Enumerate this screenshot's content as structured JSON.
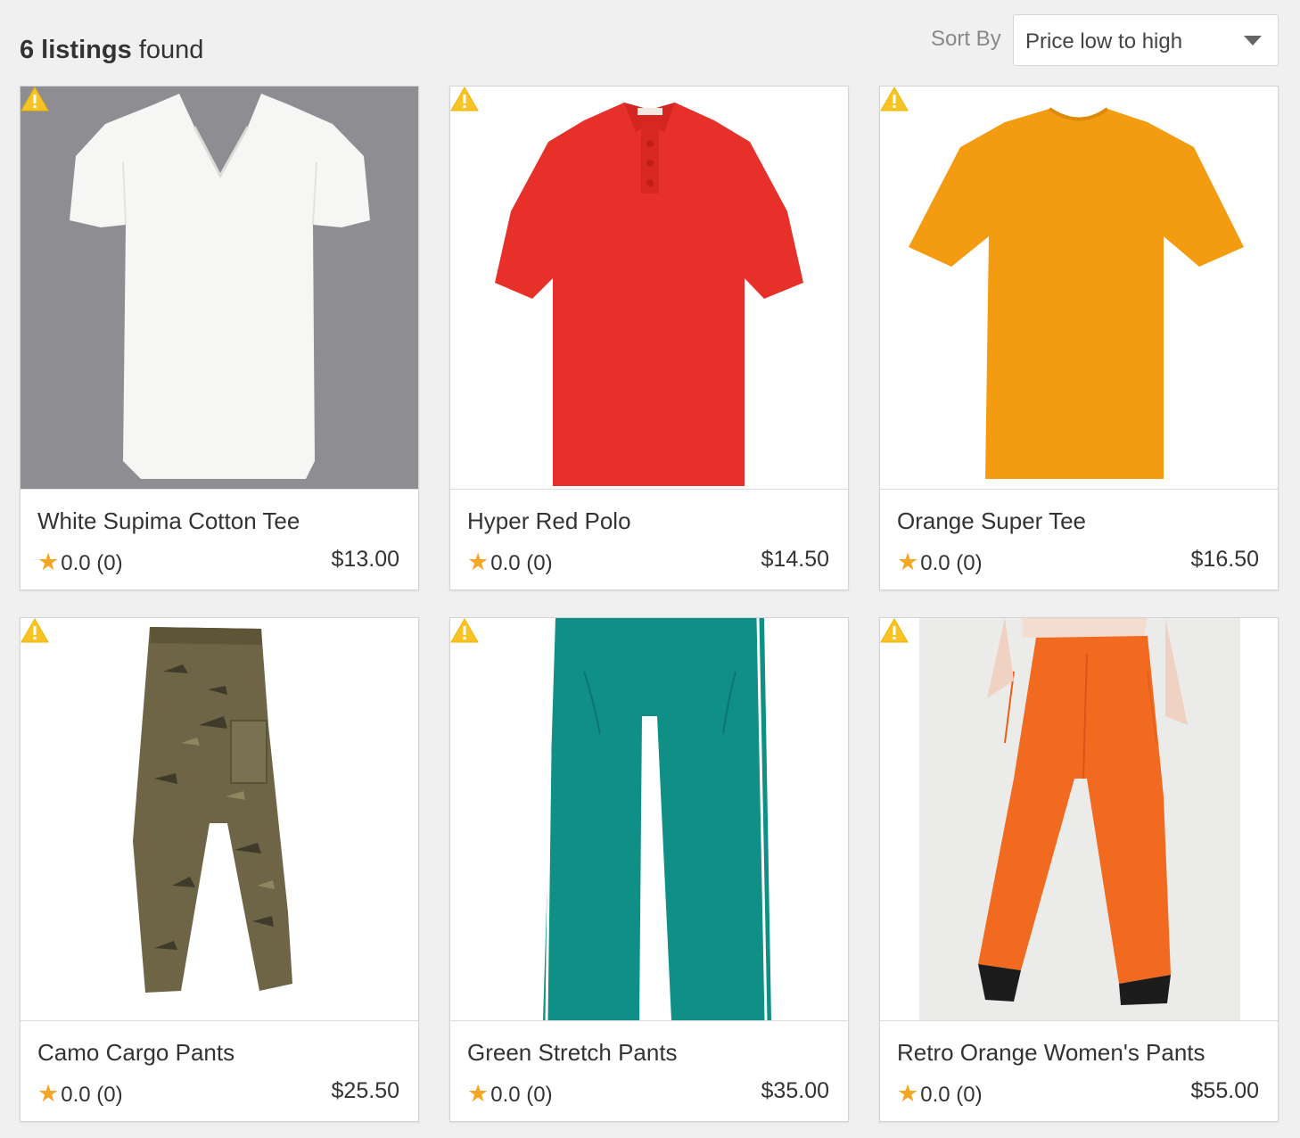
{
  "header": {
    "count_number": "6 listings",
    "count_suffix": "found",
    "sort_label": "Sort By",
    "sort_value": "Price low to high"
  },
  "listings": [
    {
      "title": "White Supima Cotton Tee",
      "rating": "0.0 (0)",
      "price": "$13.00",
      "image": "white-v-neck-tee"
    },
    {
      "title": "Hyper Red Polo",
      "rating": "0.0 (0)",
      "price": "$14.50",
      "image": "red-polo-shirt"
    },
    {
      "title": "Orange Super Tee",
      "rating": "0.0 (0)",
      "price": "$16.50",
      "image": "orange-tee"
    },
    {
      "title": "Camo Cargo Pants",
      "rating": "0.0 (0)",
      "price": "$25.50",
      "image": "camo-cargo-pants"
    },
    {
      "title": "Green Stretch Pants",
      "rating": "0.0 (0)",
      "price": "$35.00",
      "image": "green-track-pants"
    },
    {
      "title": "Retro Orange Women's Pants",
      "rating": "0.0 (0)",
      "price": "$55.00",
      "image": "orange-wide-leg-pants"
    }
  ],
  "colors": {
    "page_bg": "#f0f0f0",
    "star": "#f5a623",
    "warning": "#f7c325",
    "white_tee_bg": "#8d8d92",
    "red_polo": "#e8302a",
    "orange_tee": "#f39c12",
    "camo": "#6e6446",
    "green_pants": "#0f8f86",
    "orange_pants": "#f26a1f"
  },
  "icons": [
    "warning-icon",
    "star-icon",
    "chevron-down-icon"
  ]
}
